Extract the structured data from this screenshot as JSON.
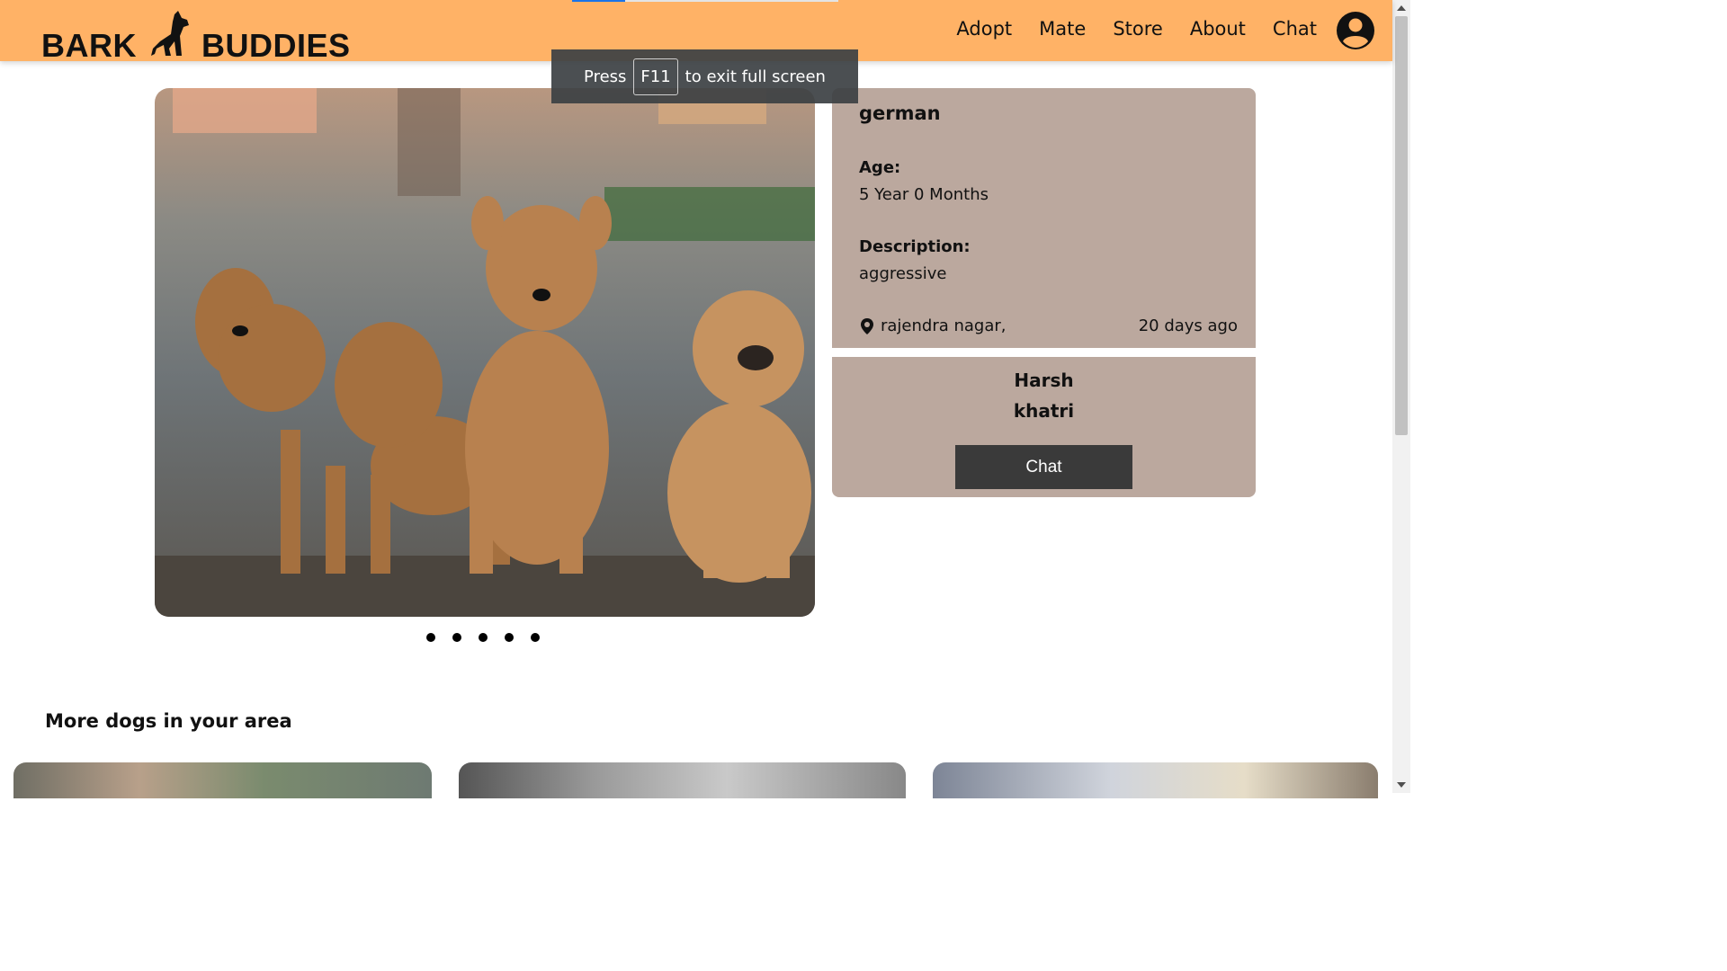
{
  "brand": {
    "left": "BARK",
    "right": "BUDDIES"
  },
  "nav": {
    "items": [
      "Adopt",
      "Mate",
      "Store",
      "About",
      "Chat"
    ]
  },
  "fullscreen_notice": {
    "press": "Press",
    "key": "F11",
    "rest": "to exit full screen"
  },
  "listing": {
    "breed": "german",
    "age_label": "Age:",
    "age_value": "5 Year 0 Months",
    "description_label": "Description:",
    "description_value": "aggressive",
    "location": "rajendra nagar,",
    "posted": "20 days ago"
  },
  "owner": {
    "first_name": "Harsh",
    "last_name": "khatri",
    "chat_label": "Chat"
  },
  "carousel": {
    "slide_count": 5,
    "active_index": 0
  },
  "more_section": {
    "title": "More dogs in your area"
  },
  "colors": {
    "navbar": "#ffb266",
    "card": "#bba89e",
    "button": "#3a3a3a"
  }
}
